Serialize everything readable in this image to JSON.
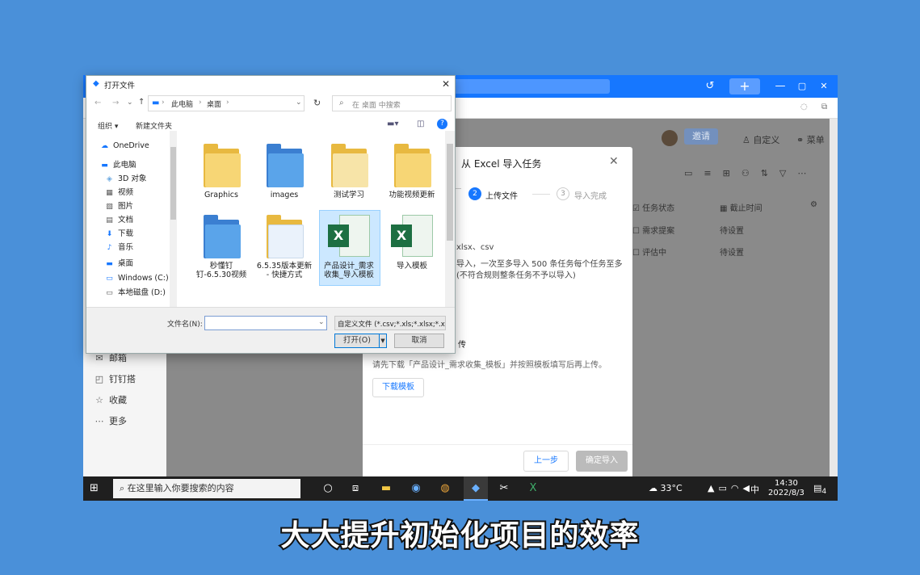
{
  "app": {
    "topbar": {
      "history_icon": "history-icon",
      "new_label": "+",
      "min": "—",
      "max": "▢",
      "close": "✕"
    },
    "header": {
      "invite": "邀请",
      "customize": "自定义",
      "menu": "菜单"
    },
    "sidebar": [
      {
        "icon": "mail-icon",
        "label": "邮箱"
      },
      {
        "icon": "ding-icon",
        "label": "钉钉搭"
      },
      {
        "icon": "star-icon",
        "label": "收藏"
      },
      {
        "icon": "more-icon",
        "label": "更多"
      }
    ],
    "table": {
      "col_status": "任务状态",
      "col_deadline": "截止时间",
      "rows": [
        {
          "status": "需求提案",
          "deadline": "待设置"
        },
        {
          "status": "评估中",
          "deadline": "待设置"
        }
      ]
    }
  },
  "import_dialog": {
    "title": "从 Excel 导入任务",
    "steps": [
      {
        "num": "2",
        "label": "上传文件"
      },
      {
        "num": "3",
        "label": "导入完成"
      }
    ],
    "formats": "xlsx、csv",
    "desc1": "导入，一次至多导入 500 条任务每个任务至多",
    "desc2": "(不符合规则整条任务不予以导入)",
    "upload_heading": "传",
    "template_tip": "请先下载「产品设计_需求收集_模板」并按照模板填写后再上传。",
    "download_label": "下载模板",
    "prev_label": "上一步",
    "confirm_label": "确定导入"
  },
  "file_dialog": {
    "title": "打开文件",
    "path": [
      "此电脑",
      "桌面"
    ],
    "search_placeholder": "在 桌面 中搜索",
    "organize": "组织 ▾",
    "new_folder": "新建文件夹",
    "nav": [
      {
        "icon": "cloud-icon",
        "label": "OneDrive"
      },
      {
        "icon": "pc-icon",
        "label": "此电脑"
      },
      {
        "icon": "cube-icon",
        "label": "3D 对象"
      },
      {
        "icon": "video-icon",
        "label": "视频"
      },
      {
        "icon": "picture-icon",
        "label": "图片"
      },
      {
        "icon": "document-icon",
        "label": "文档"
      },
      {
        "icon": "download-icon",
        "label": "下载"
      },
      {
        "icon": "music-icon",
        "label": "音乐"
      },
      {
        "icon": "desktop-icon",
        "label": "桌面"
      },
      {
        "icon": "drive-icon",
        "label": "Windows (C:)"
      },
      {
        "icon": "drive-icon",
        "label": "本地磁盘 (D:)"
      }
    ],
    "files": [
      {
        "label": "Graphics",
        "kind": "folder"
      },
      {
        "label": "images",
        "kind": "folder-blue"
      },
      {
        "label": "测试学习",
        "kind": "folder"
      },
      {
        "label": "功能视频更新",
        "kind": "folder"
      },
      {
        "label": "秒懂钉钉-6.5.30视频",
        "kind": "folder-blue"
      },
      {
        "label": "6.5.35版本更新 - 快捷方式",
        "kind": "shortcut"
      },
      {
        "label": "产品设计_需求收集_导入模板",
        "kind": "xls"
      },
      {
        "label": "导入模板",
        "kind": "xls"
      }
    ],
    "filename_label": "文件名(N):",
    "filename_value": "",
    "filter": "自定义文件 (*.csv;*.xls;*.xlsx;*.x",
    "open_label": "打开(O)",
    "cancel_label": "取消"
  },
  "taskbar": {
    "search_placeholder": "在这里输入你要搜索的内容",
    "weather": "33°C",
    "ime": "中",
    "time": "14:30",
    "date": "2022/8/3",
    "notifications": "4"
  },
  "caption": "大大提升初始化项目的效率"
}
